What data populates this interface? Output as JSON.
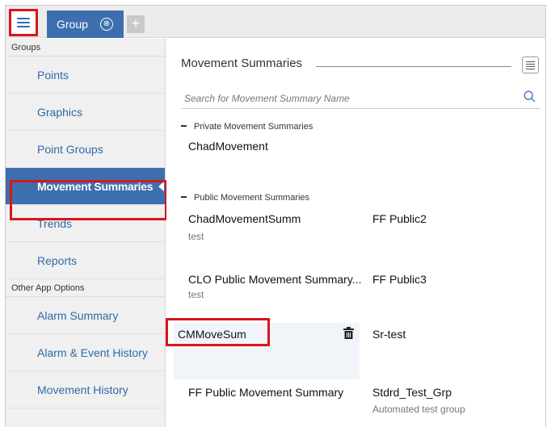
{
  "tab": {
    "label": "Group",
    "close_glyph": "⊗",
    "add_glyph": "+"
  },
  "icons": {
    "menu": "hamburger-icon",
    "close": "close-circle-icon",
    "add": "plus-icon",
    "list": "list-view-icon",
    "search": "search-icon",
    "delete": "trash-icon"
  },
  "colors": {
    "accent": "#3d6fae",
    "highlight": "#d9151b",
    "link": "#2f6aa6"
  },
  "sidebar": {
    "groups_header": "Groups",
    "groups": [
      {
        "label": "Points"
      },
      {
        "label": "Graphics"
      },
      {
        "label": "Point Groups"
      },
      {
        "label": "Movement Summaries"
      },
      {
        "label": "Trends"
      },
      {
        "label": "Reports"
      }
    ],
    "other_header": "Other App Options",
    "other": [
      {
        "label": "Alarm Summary"
      },
      {
        "label": "Alarm & Event History"
      },
      {
        "label": "Movement History"
      }
    ]
  },
  "main": {
    "title": "Movement Summaries",
    "search": {
      "placeholder": "Search for Movement Summary Name"
    },
    "private_header": "Private Movement Summaries",
    "private_items": [
      {
        "name": "ChadMovement"
      }
    ],
    "public_header": "Public Movement Summaries",
    "public_items": [
      {
        "name": "ChadMovementSumm",
        "desc": "test"
      },
      {
        "name": "FF Public2",
        "desc": ""
      },
      {
        "name": "CLO Public Movement Summary...",
        "desc": "test"
      },
      {
        "name": "FF Public3",
        "desc": ""
      },
      {
        "name": "CMMoveSum",
        "desc": ""
      },
      {
        "name": "Sr-test",
        "desc": ""
      },
      {
        "name": "FF Public Movement Summary",
        "desc": ""
      },
      {
        "name": "Stdrd_Test_Grp",
        "desc": "Automated test group"
      }
    ]
  }
}
